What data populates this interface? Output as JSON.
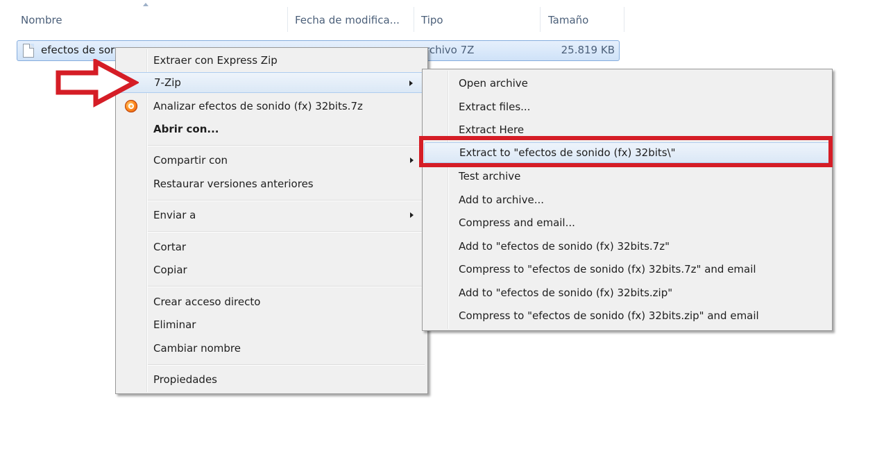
{
  "columns": {
    "name": "Nombre",
    "date": "Fecha de modifica...",
    "type": "Tipo",
    "size": "Tamaño"
  },
  "file": {
    "name_visible": "efectos de sor",
    "type_visible": "rchivo 7Z",
    "size": "25.819 KB"
  },
  "context_menu": {
    "items": [
      {
        "label": "Extraer con Express Zip"
      },
      {
        "label": "7-Zip",
        "submenu": true
      },
      {
        "label": "Analizar efectos de sonido (fx) 32bits.7z",
        "icon": "analyze-app-icon"
      },
      {
        "label": "Abrir con...",
        "bold": true
      },
      {
        "label": "Compartir con",
        "submenu": true
      },
      {
        "label": "Restaurar versiones anteriores"
      },
      {
        "label": "Enviar a",
        "submenu": true
      },
      {
        "label": "Cortar"
      },
      {
        "label": "Copiar"
      },
      {
        "label": "Crear acceso directo"
      },
      {
        "label": "Eliminar"
      },
      {
        "label": "Cambiar nombre"
      },
      {
        "label": "Propiedades"
      }
    ]
  },
  "sevenzip_menu": {
    "items": [
      {
        "label": "Open archive"
      },
      {
        "label": "Extract files..."
      },
      {
        "label": "Extract Here"
      },
      {
        "label": "Extract to \"efectos de sonido (fx) 32bits\\\""
      },
      {
        "label": "Test archive"
      },
      {
        "label": "Add to archive..."
      },
      {
        "label": "Compress and email..."
      },
      {
        "label": "Add to \"efectos de sonido (fx) 32bits.7z\""
      },
      {
        "label": "Compress to \"efectos de sonido (fx) 32bits.7z\" and email"
      },
      {
        "label": "Add to \"efectos de sonido (fx) 32bits.zip\""
      },
      {
        "label": "Compress to \"efectos de sonido (fx) 32bits.zip\" and email"
      }
    ]
  },
  "annotation_color": "#d51d26"
}
